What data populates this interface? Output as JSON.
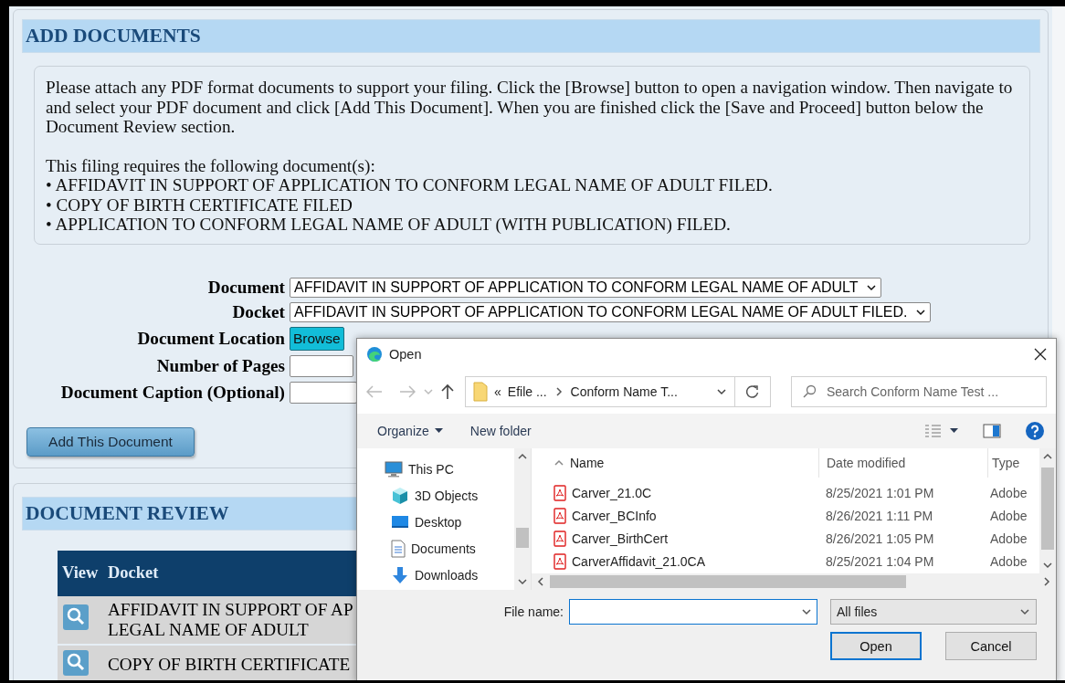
{
  "add_documents": {
    "title": "ADD DOCUMENTS",
    "instructions": "Please attach any PDF format documents to support your filing. Click the [Browse] button to open a navigation window. Then navigate to and select your PDF document and click [Add This Document]. When you are finished click the [Save and Proceed] button below the Document Review section.",
    "required_intro": "This filing requires the following document(s):",
    "required": [
      {
        "bullet": "•",
        "text": "AFFIDAVIT IN SUPPORT OF APPLICATION TO CONFORM LEGAL NAME OF ADULT FILED."
      },
      {
        "bullet": "•",
        "text": "COPY OF BIRTH CERTIFICATE FILED"
      },
      {
        "bullet": "•",
        "text": "APPLICATION TO CONFORM LEGAL NAME OF ADULT (WITH PUBLICATION) FILED."
      }
    ]
  },
  "form": {
    "fields": [
      {
        "label": "Document",
        "kind": "select",
        "value": "AFFIDAVIT IN SUPPORT OF APPLICATION TO CONFORM LEGAL NAME OF ADULT"
      },
      {
        "label": "Docket",
        "kind": "select",
        "value": "AFFIDAVIT IN SUPPORT OF APPLICATION TO CONFORM LEGAL NAME OF ADULT FILED."
      },
      {
        "label": "Document Location",
        "kind": "file",
        "button": "Browse"
      },
      {
        "label": "Number of Pages",
        "kind": "text"
      },
      {
        "label": "Document Caption (Optional)",
        "kind": "text"
      }
    ],
    "add_button": "Add This Document"
  },
  "document_review": {
    "title": "DOCUMENT REVIEW",
    "columns": [
      "View",
      "Docket"
    ],
    "rows": [
      {
        "docket": [
          "AFFIDAVIT IN SUPPORT OF AP",
          "LEGAL NAME OF ADULT"
        ]
      },
      {
        "docket": [
          "COPY OF BIRTH CERTIFICATE"
        ]
      }
    ]
  },
  "dialog": {
    "title": "Open",
    "breadcrumb": {
      "overflow": "«",
      "items": [
        "Efile ...",
        "Conform Name T..."
      ]
    },
    "search_placeholder": "Search Conform Name Test ...",
    "toolbar": {
      "organize": "Organize",
      "new_folder": "New folder"
    },
    "nav": [
      {
        "label": "This PC",
        "kind": "pc",
        "children": [
          {
            "label": "3D Objects",
            "kind": "cube"
          },
          {
            "label": "Desktop",
            "kind": "desktop"
          },
          {
            "label": "Documents",
            "kind": "documents"
          },
          {
            "label": "Downloads",
            "kind": "downloads"
          }
        ]
      }
    ],
    "columns": [
      "Name",
      "Date modified",
      "Type"
    ],
    "files": [
      {
        "name": "Carver_21.0C",
        "date": "8/25/2021 1:01 PM",
        "type": "Adobe"
      },
      {
        "name": "Carver_BCInfo",
        "date": "8/26/2021 1:11 PM",
        "type": "Adobe"
      },
      {
        "name": "Carver_BirthCert",
        "date": "8/26/2021 1:05 PM",
        "type": "Adobe"
      },
      {
        "name": "CarverAffidavit_21.0CA",
        "date": "8/25/2021 1:04 PM",
        "type": "Adobe"
      }
    ],
    "file_name_label": "File name:",
    "filter": "All files",
    "buttons": [
      {
        "label": "Open",
        "default": true
      },
      {
        "label": "Cancel",
        "default": false
      }
    ]
  }
}
